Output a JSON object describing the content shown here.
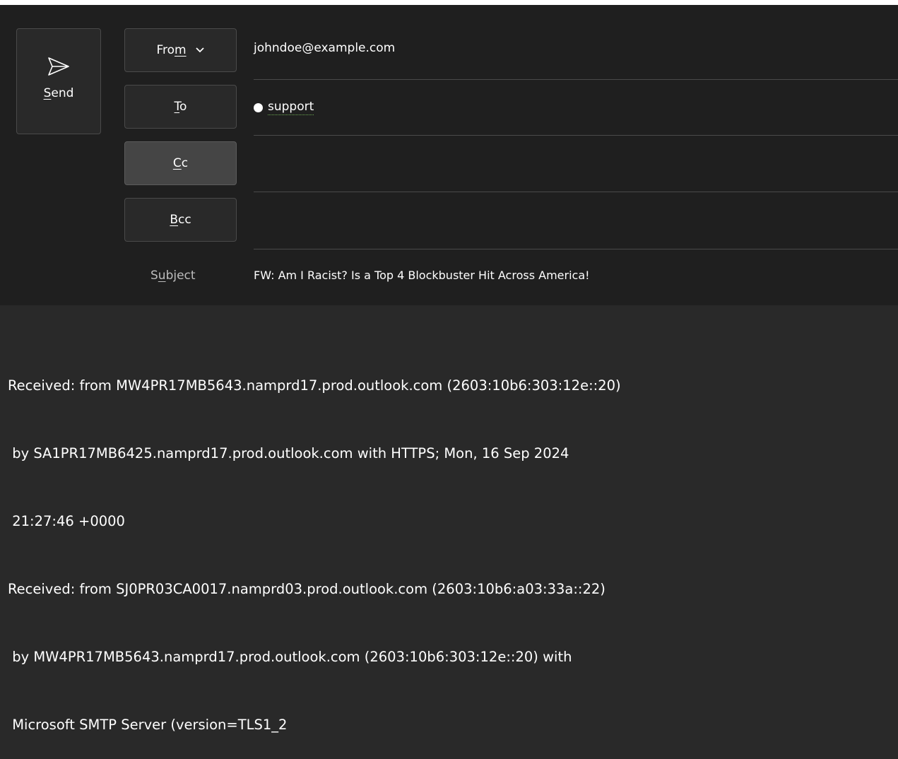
{
  "toolbar": {
    "send_label_first": "S",
    "send_label_rest": "end"
  },
  "header": {
    "from_button": {
      "prefix": "Fro",
      "underline": "m"
    },
    "to_button": {
      "underline": "T",
      "rest": "o"
    },
    "cc_button": {
      "underline": "C",
      "rest": "c"
    },
    "bcc_button": {
      "underline": "B",
      "rest": "cc"
    },
    "from_value": "johndoe@example.com",
    "to_recipient": "support",
    "cc_value": "",
    "bcc_value": "",
    "subject_label": {
      "prefix": "S",
      "underline": "u",
      "rest": "bject"
    },
    "subject_value": "FW: Am I Racist? Is a Top 4 Blockbuster Hit Across America!"
  },
  "body": {
    "lines": [
      "Received: from MW4PR17MB5643.namprd17.prod.outlook.com (2603:10b6:303:12e::20)",
      " by SA1PR17MB6425.namprd17.prod.outlook.com with HTTPS; Mon, 16 Sep 2024",
      " 21:27:46 +0000",
      "Received: from SJ0PR03CA0017.namprd03.prod.outlook.com (2603:10b6:a03:33a::22)",
      " by MW4PR17MB5643.namprd17.prod.outlook.com (2603:10b6:303:12e::20) with",
      " Microsoft SMTP Server (version=TLS1_2"
    ]
  }
}
